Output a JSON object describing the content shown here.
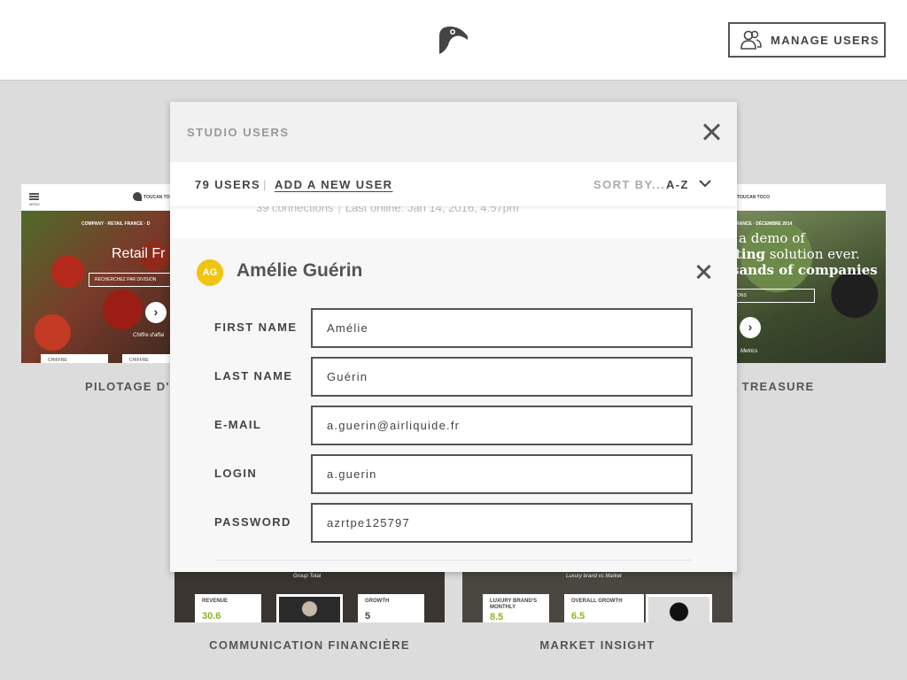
{
  "header": {
    "manage_users_label": "MANAGE USERS"
  },
  "cards": {
    "pilotage": {
      "title": "PILOTAGE D'A",
      "brand": "TOUCAN TOCO",
      "menu": "MENU",
      "subtitle": "COMPANY · RETAIL FRANCE · D",
      "heading": "Retail Fr",
      "button": "RECHERCHEZ PAR DIVISION",
      "footer": "Chiffre d'affai",
      "tab1": "CHIFFRE",
      "tab2": "CHIFFRE"
    },
    "treasure": {
      "title": "N TREASURE",
      "brand": "TOUCAN TOCO",
      "subtitle": "FRANCE · DÉCEMBRE 2014",
      "line1": "a demo of",
      "line2a": "ting",
      "line2b": " solution ever.",
      "line3": "sands of companies",
      "button": "TONS",
      "footer": "Metrics"
    },
    "communication": {
      "title": "COMMUNICATION FINANCIÈRE",
      "group": "Group Total",
      "revenue_label": "REVENUE",
      "revenue_value": "30.6",
      "growth_label": "GROWTH",
      "growth_value": "5"
    },
    "market": {
      "title": "MARKET INSIGHT",
      "subtitle": "Luxury brand vs Market",
      "kpi1_label": "LUXURY BRAND'S MONTHLY",
      "kpi1_value": "8.5",
      "kpi2_label": "OVERALL GROWTH",
      "kpi2_value": "6.5"
    }
  },
  "modal": {
    "title": "STUDIO USERS",
    "users_count": "79 USERS",
    "separator": "|",
    "add_user_label": "ADD A NEW USER",
    "sort_label": "SORT BY...",
    "sort_value": "A-Z",
    "previous_user": {
      "connections": "39 connections",
      "last_online": "Last online: Jan 14, 2016, 4:57pm"
    },
    "user": {
      "initials": "AG",
      "name": "Amélie Guérin",
      "fields": [
        {
          "label": "FIRST NAME",
          "value": "Amélie"
        },
        {
          "label": "LAST NAME",
          "value": "Guérin"
        },
        {
          "label": "E-MAIL",
          "value": "a.guerin@airliquide.fr"
        },
        {
          "label": "LOGIN",
          "value": "a.guerin"
        },
        {
          "label": "PASSWORD",
          "value": "azrtpe125797"
        }
      ]
    }
  },
  "colors": {
    "background": "#dcdcdc",
    "avatar": "#f1c40f",
    "border": "#555555",
    "growth_green": "#8ab61f"
  }
}
